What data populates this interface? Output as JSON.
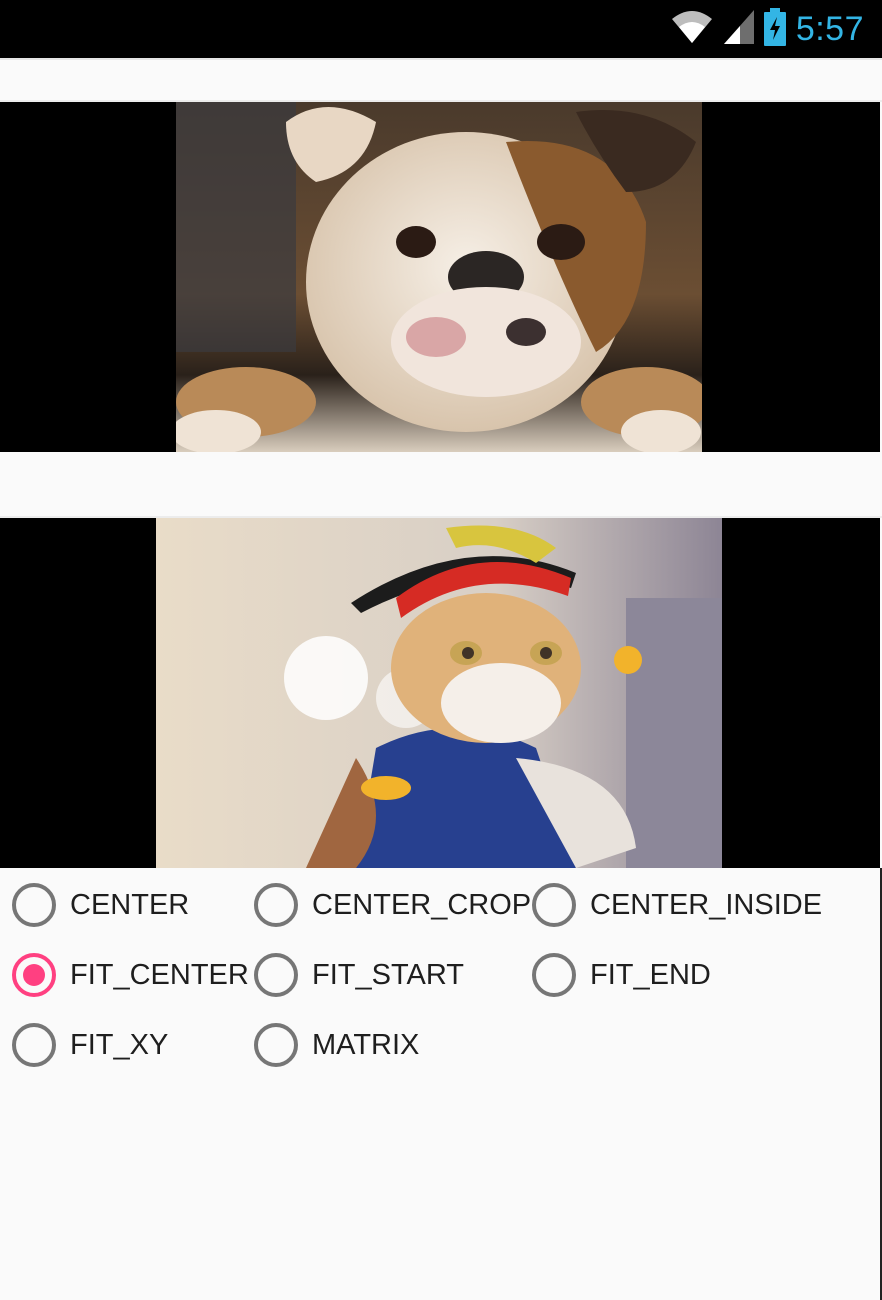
{
  "status_bar": {
    "time": "5:57",
    "icons": [
      "wifi-icon",
      "cell-signal-icon",
      "battery-charging-icon"
    ],
    "clock_color": "#33b5e5"
  },
  "images": [
    {
      "name": "bulldog-photo",
      "subject": "bulldog"
    },
    {
      "name": "pirate-cat-photo",
      "subject": "cat in pirate costume"
    }
  ],
  "scale_types": {
    "accent_color": "#ff4081",
    "selected": "FIT_CENTER",
    "options": [
      {
        "label": "CENTER",
        "checked": false
      },
      {
        "label": "CENTER_CROP",
        "checked": false
      },
      {
        "label": "CENTER_INSIDE",
        "checked": false
      },
      {
        "label": "FIT_CENTER",
        "checked": true
      },
      {
        "label": "FIT_START",
        "checked": false
      },
      {
        "label": "FIT_END",
        "checked": false
      },
      {
        "label": "FIT_XY",
        "checked": false
      },
      {
        "label": "MATRIX",
        "checked": false
      }
    ]
  }
}
